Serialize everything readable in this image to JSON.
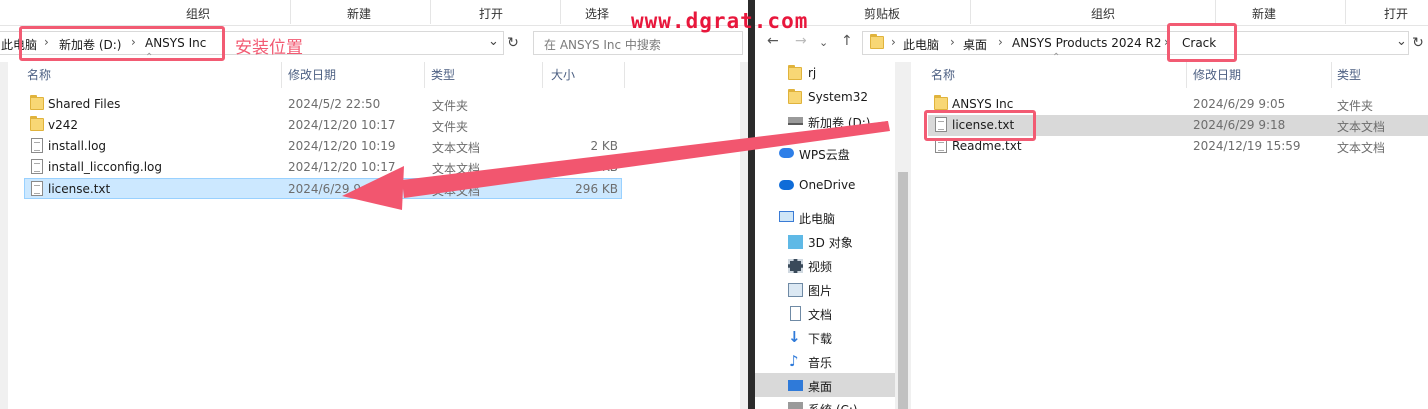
{
  "left": {
    "ribbon": [
      "组织",
      "新建",
      "打开",
      "选择"
    ],
    "breadcrumb": [
      "此电脑",
      "新加卷 (D:)",
      "ANSYS Inc"
    ],
    "search_placeholder": "在 ANSYS Inc 中搜索",
    "columns": {
      "name": "名称",
      "date": "修改日期",
      "type": "类型",
      "size": "大小"
    },
    "files": [
      {
        "name": "Shared Files",
        "date": "2024/5/2 22:50",
        "type": "文件夹",
        "size": "",
        "icon": "folder-icon"
      },
      {
        "name": "v242",
        "date": "2024/12/20 10:17",
        "type": "文件夹",
        "size": "",
        "icon": "folder-icon"
      },
      {
        "name": "install.log",
        "date": "2024/12/20 10:19",
        "type": "文本文档",
        "size": "2 KB",
        "icon": "text-file-icon"
      },
      {
        "name": "install_licconfig.log",
        "date": "2024/12/20 10:17",
        "type": "文本文档",
        "size": "11 KB",
        "icon": "text-file-icon"
      },
      {
        "name": "license.txt",
        "date": "2024/6/29 9:18",
        "type": "文本文档",
        "size": "296 KB",
        "icon": "text-file-icon"
      }
    ],
    "annotation": "安装位置"
  },
  "watermark": "www.dgrat.com",
  "right": {
    "ribbon": [
      "剪贴板",
      "组织",
      "新建",
      "打开"
    ],
    "breadcrumb": [
      "此电脑",
      "桌面",
      "ANSYS Products 2024 R2",
      "Crack"
    ],
    "columns": {
      "name": "名称",
      "date": "修改日期",
      "type": "类型"
    },
    "files": [
      {
        "name": "ANSYS Inc",
        "date": "2024/6/29 9:05",
        "type": "文件夹",
        "icon": "folder-icon"
      },
      {
        "name": "license.txt",
        "date": "2024/6/29 9:18",
        "type": "文本文档",
        "icon": "text-file-icon"
      },
      {
        "name": "Readme.txt",
        "date": "2024/12/19 15:59",
        "type": "文本文档",
        "icon": "text-file-icon"
      }
    ],
    "tree": [
      {
        "label": "rj",
        "icon": "folder-icon"
      },
      {
        "label": "System32",
        "icon": "folder-icon"
      },
      {
        "label": "新加卷 (D:)",
        "icon": "drive-icon"
      },
      {
        "label": "WPS云盘",
        "icon": "cloud-icon"
      },
      {
        "label": "OneDrive",
        "icon": "onedrive-icon"
      },
      {
        "label": "此电脑",
        "icon": "computer-icon"
      },
      {
        "label": "3D 对象",
        "icon": "3d-objects-icon"
      },
      {
        "label": "视频",
        "icon": "video-icon"
      },
      {
        "label": "图片",
        "icon": "pictures-icon"
      },
      {
        "label": "文档",
        "icon": "documents-icon"
      },
      {
        "label": "下载",
        "icon": "download-icon"
      },
      {
        "label": "音乐",
        "icon": "music-icon"
      },
      {
        "label": "桌面",
        "icon": "desktop-icon"
      },
      {
        "label": "系统 (C:)",
        "icon": "drive-icon"
      }
    ]
  }
}
